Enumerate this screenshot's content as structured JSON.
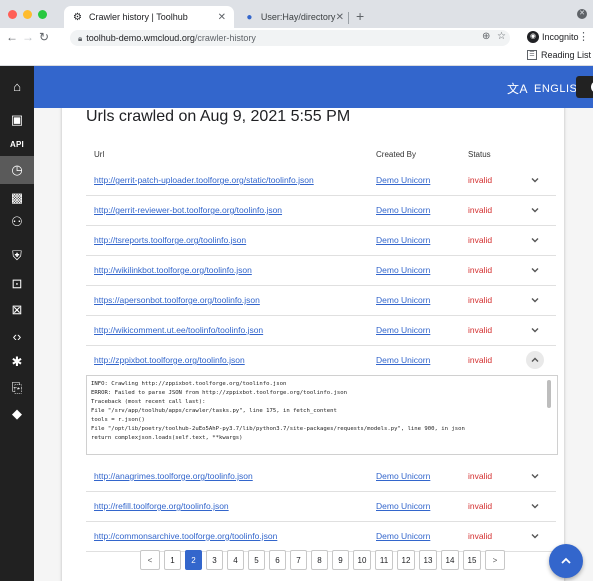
{
  "browser": {
    "tabs": [
      {
        "title": "Crawler history | Toolhub",
        "active": true
      },
      {
        "title": "User:Hay/directory - Wikitech",
        "active": false
      }
    ],
    "url_host": "toolhub-demo.wmcloud.org",
    "url_path": "/crawler-history",
    "profile": "Incognito",
    "reading_list": "Reading List"
  },
  "sidebar": {
    "items": [
      {
        "icon": "home-icon",
        "glyph": "⌂"
      },
      {
        "icon": "add-tool-icon",
        "glyph": "▣"
      },
      {
        "icon": "api-icon",
        "text": "API"
      },
      {
        "icon": "history-icon",
        "glyph": "◷",
        "active": true
      },
      {
        "icon": "qr-icon",
        "glyph": "▩"
      },
      {
        "icon": "members-icon",
        "glyph": "⚇"
      },
      {
        "icon": "shield-icon",
        "glyph": "⛨"
      },
      {
        "icon": "lists-icon",
        "glyph": "⊡"
      },
      {
        "icon": "audit-icon",
        "glyph": "⊠"
      },
      {
        "icon": "code-icon",
        "glyph": "‹›"
      },
      {
        "icon": "bug-icon",
        "glyph": "✱"
      },
      {
        "icon": "docs-icon",
        "glyph": "⎘"
      },
      {
        "icon": "diff-icon",
        "glyph": "◆"
      }
    ]
  },
  "header": {
    "language": "ENGLISH"
  },
  "main": {
    "title": "Urls crawled on Aug 9, 2021 5:55 PM",
    "columns": {
      "url": "Url",
      "created_by": "Created By",
      "status": "Status"
    },
    "rows": [
      {
        "url": "http://gerrit-patch-uploader.toolforge.org/static/toolinfo.json",
        "created_by": "Demo Unicorn",
        "status": "invalid",
        "expanded": false
      },
      {
        "url": "http://gerrit-reviewer-bot.toolforge.org/toolinfo.json",
        "created_by": "Demo Unicorn",
        "status": "invalid",
        "expanded": false
      },
      {
        "url": "http://tsreports.toolforge.org/toolinfo.json",
        "created_by": "Demo Unicorn",
        "status": "invalid",
        "expanded": false
      },
      {
        "url": "http://wikilinkbot.toolforge.org/toolinfo.json",
        "created_by": "Demo Unicorn",
        "status": "invalid",
        "expanded": false
      },
      {
        "url": "https://apersonbot.toolforge.org/toolinfo.json",
        "created_by": "Demo Unicorn",
        "status": "invalid",
        "expanded": false
      },
      {
        "url": "http://wikicomment.ut.ee/toolinfo/toolinfo.json",
        "created_by": "Demo Unicorn",
        "status": "invalid",
        "expanded": false
      },
      {
        "url": "http://zppixbot.toolforge.org/toolinfo.json",
        "created_by": "Demo Unicorn",
        "status": "invalid",
        "expanded": true
      },
      {
        "url": "http://anagrimes.toolforge.org/toolinfo.json",
        "created_by": "Demo Unicorn",
        "status": "invalid",
        "expanded": false
      },
      {
        "url": "http://refill.toolforge.org/toolinfo.json",
        "created_by": "Demo Unicorn",
        "status": "invalid",
        "expanded": false
      },
      {
        "url": "http://commonsarchive.toolforge.org/toolinfo.json",
        "created_by": "Demo Unicorn",
        "status": "invalid",
        "expanded": false
      }
    ],
    "log_lines": [
      "INFO: Crawling http://zppixbot.toolforge.org/toolinfo.json",
      "ERROR: Failed to parse JSON from http://zppixbot.toolforge.org/toolinfo.json",
      "Traceback (most recent call last):",
      "File \"/srv/app/toolhub/apps/crawler/tasks.py\", line 175, in fetch_content",
      "tools = r.json()",
      "File \"/opt/lib/poetry/toolhub-2uEo5AhP-py3.7/lib/python3.7/site-packages/requests/models.py\", line 900, in json",
      "return complexjson.loads(self.text, **kwargs)"
    ],
    "pagination": {
      "prev": "<",
      "next": ">",
      "pages": [
        "1",
        "2",
        "3",
        "4",
        "5",
        "6",
        "7",
        "8",
        "9",
        "10",
        "11",
        "12",
        "13",
        "14",
        "15"
      ],
      "current": "2"
    }
  },
  "colors": {
    "brand": "#3366cc",
    "sidebar": "#212121",
    "invalid": "#d32f2f"
  }
}
